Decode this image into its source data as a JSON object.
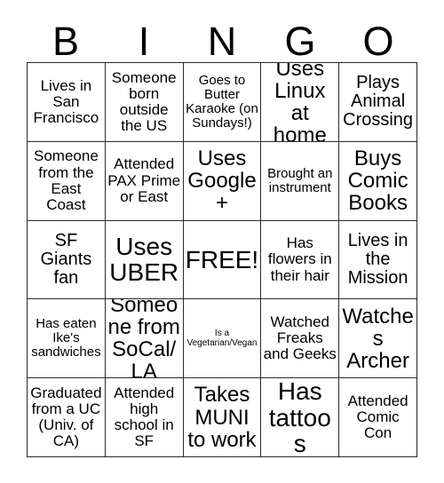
{
  "card": {
    "header_letters": [
      "B",
      "I",
      "N",
      "G",
      "O"
    ],
    "colors": {
      "background": "#ffffff",
      "text": "#000000",
      "grid_line": "#2b2b2b"
    },
    "rows": [
      [
        {
          "text": "Lives in San Francisco",
          "size": "md"
        },
        {
          "text": "Someone born outside the US",
          "size": "md"
        },
        {
          "text": "Goes to Butter Karaoke (on Sundays!)",
          "size": "sm"
        },
        {
          "text": "Uses Linux at home",
          "size": "xl"
        },
        {
          "text": "Plays Animal Crossing",
          "size": "lg"
        }
      ],
      [
        {
          "text": "Someone from the East Coast",
          "size": "md"
        },
        {
          "text": "Attended PAX Prime or East",
          "size": "md"
        },
        {
          "text": "Uses Google+",
          "size": "xl"
        },
        {
          "text": "Brought an instrument",
          "size": "sm"
        },
        {
          "text": "Buys Comic Books",
          "size": "xl"
        }
      ],
      [
        {
          "text": "SF Giants fan",
          "size": "lg"
        },
        {
          "text": "Uses UBER",
          "size": "xxl"
        },
        {
          "text": "FREE!",
          "size": "xxl"
        },
        {
          "text": "Has flowers in their hair",
          "size": "md"
        },
        {
          "text": "Lives in the Mission",
          "size": "lg"
        }
      ],
      [
        {
          "text": "Has eaten Ike's sandwiches",
          "size": "sm"
        },
        {
          "text": "Someone from SoCal/LA",
          "size": "xl"
        },
        {
          "text": "Is a Vegetarian/Vegan",
          "size": "xs"
        },
        {
          "text": "Watched Freaks and Geeks",
          "size": "md"
        },
        {
          "text": "Watches Archer",
          "size": "xl"
        }
      ],
      [
        {
          "text": "Graduated from a UC (Univ. of CA)",
          "size": "md"
        },
        {
          "text": "Attended high school in SF",
          "size": "md"
        },
        {
          "text": "Takes MUNI to work",
          "size": "xl"
        },
        {
          "text": "Has tattoos",
          "size": "xxl"
        },
        {
          "text": "Attended Comic Con",
          "size": "md"
        }
      ]
    ]
  }
}
